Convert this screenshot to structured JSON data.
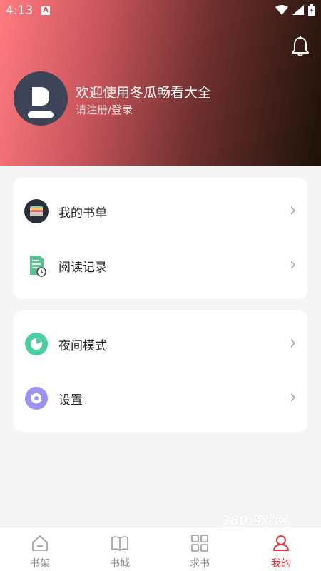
{
  "status_bar": {
    "time": "4:13",
    "notification_badge": "A"
  },
  "profile": {
    "welcome_text": "欢迎使用冬瓜畅看大全",
    "login_text": "请注册/登录"
  },
  "menu_group_1": [
    {
      "label": "我的书单",
      "icon": "booklist-icon"
    },
    {
      "label": "阅读记录",
      "icon": "reading-history-icon"
    }
  ],
  "menu_group_2": [
    {
      "label": "夜间模式",
      "icon": "night-mode-icon"
    },
    {
      "label": "设置",
      "icon": "settings-icon"
    }
  ],
  "watermark": "380游戏网",
  "tabs": [
    {
      "label": "书架",
      "icon": "bookshelf-icon"
    },
    {
      "label": "书城",
      "icon": "bookstore-icon"
    },
    {
      "label": "求书",
      "icon": "request-book-icon"
    },
    {
      "label": "我的",
      "icon": "profile-icon",
      "active": true
    }
  ],
  "colors": {
    "accent": "#e8323c",
    "header_start": "#ff7a80",
    "header_end": "#1c1208"
  }
}
